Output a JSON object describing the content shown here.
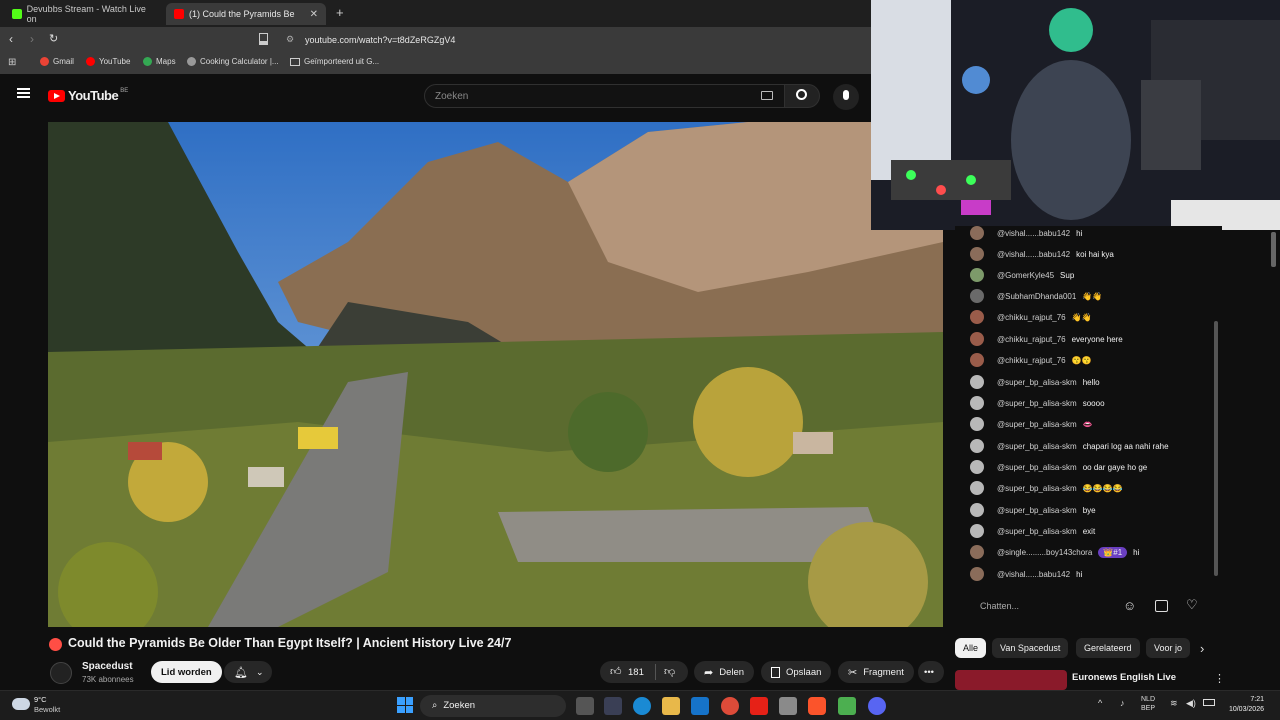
{
  "browser": {
    "tabs": [
      {
        "label": "Devubbs Stream - Watch Live on",
        "active": false
      },
      {
        "label": "(1)   Could the Pyramids Be",
        "active": true
      }
    ],
    "url": "youtube.com/watch?v=t8dZeRGZgV4",
    "bookmarks": [
      "Gmail",
      "YouTube",
      "Maps",
      "Cooking Calculator |...",
      "Geïmporteerd uit G..."
    ]
  },
  "youtube": {
    "logo_text": "YouTube",
    "country": "BE",
    "search_placeholder": "Zoeken"
  },
  "video": {
    "title": "Could the Pyramids Be Older Than Egypt Itself? | Ancient History Live 24/7",
    "channel": "Spacedust",
    "subscribers": "73K abonnees",
    "join_label": "Lid worden",
    "likes": "181",
    "share_label": "Delen",
    "save_label": "Opslaan",
    "clip_label": "Fragment"
  },
  "chat": {
    "messages": [
      {
        "author": "@vishal......babu142",
        "text": "hi"
      },
      {
        "author": "@vishal......babu142",
        "text": "koi hai kya"
      },
      {
        "author": "@GomerKyle45",
        "text": "Sup"
      },
      {
        "author": "@SubhamDhanda001",
        "text": "👋👋"
      },
      {
        "author": "@chikku_rajput_76",
        "text": "👋👋"
      },
      {
        "author": "@chikku_rajput_76",
        "text": "everyone here"
      },
      {
        "author": "@chikku_rajput_76",
        "text": "😗😗"
      },
      {
        "author": "@super_bp_alisa-skm",
        "text": "hello"
      },
      {
        "author": "@super_bp_alisa-skm",
        "text": "soooo"
      },
      {
        "author": "@super_bp_alisa-skm",
        "text": "👄"
      },
      {
        "author": "@super_bp_alisa-skm",
        "text": "chapari log aa nahi rahe"
      },
      {
        "author": "@super_bp_alisa-skm",
        "text": "oo dar gaye ho ge"
      },
      {
        "author": "@super_bp_alisa-skm",
        "text": "😂😂😂😂"
      },
      {
        "author": "@super_bp_alisa-skm",
        "text": "bye"
      },
      {
        "author": "@super_bp_alisa-skm",
        "text": "exit"
      },
      {
        "author": "@single.........boy143chora",
        "badge": "👑#1",
        "text": "hi"
      },
      {
        "author": "@vishal......babu142",
        "text": "hi"
      }
    ],
    "input_placeholder": "Chatten..."
  },
  "chips": [
    "Alle",
    "Van Spacedust",
    "Gerelateerd",
    "Voor jo"
  ],
  "related": {
    "title": "Euronews English Live"
  },
  "taskbar": {
    "weather_temp": "9°C",
    "weather_desc": "Bewolkt",
    "search_label": "Zoeken",
    "lang_top": "NLD",
    "lang_bottom": "BEP",
    "time": "7:21",
    "date": "10/03/2026"
  },
  "colors": {
    "accent_red": "#ff0000",
    "bg": "#0f0f0f",
    "chip_bg": "#272727"
  }
}
